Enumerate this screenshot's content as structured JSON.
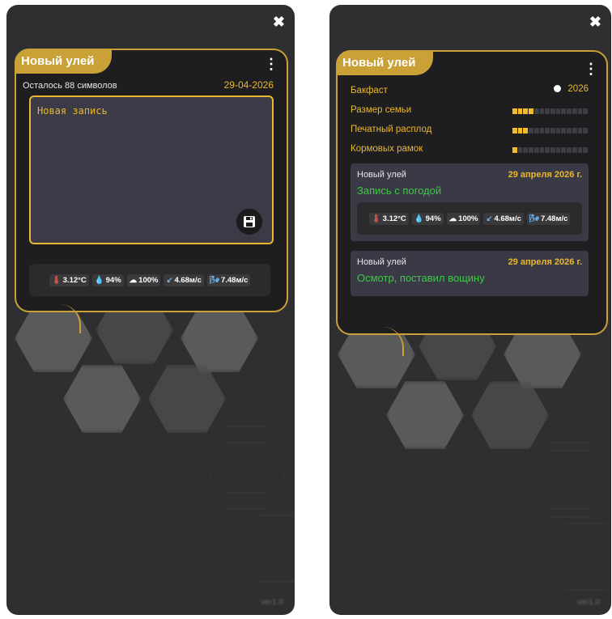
{
  "left": {
    "close_icon": "close-icon",
    "card_title": "Новый улей",
    "chars_left": "Осталось 88 символов",
    "date": "29-04-2026",
    "editor_value": "Новая запись",
    "weather": {
      "temp": "3.12°C",
      "humidity": "94%",
      "clouds": "100%",
      "wind": "4.68м/с",
      "gust": "7.48м/с"
    }
  },
  "right": {
    "card_title": "Новый улей",
    "breed_label": "Бакфаст",
    "breed_year": "2026",
    "rows": [
      {
        "label": "Размер семьи",
        "level": 4,
        "max": 14
      },
      {
        "label": "Печатный расплод",
        "level": 3,
        "max": 14
      },
      {
        "label": "Кормовых рамок",
        "level": 1,
        "max": 14
      }
    ],
    "entries": [
      {
        "hive": "Новый улей",
        "date": "29 апреля 2026 г.",
        "text": "Запись с погодой"
      },
      {
        "hive": "Новый улей",
        "date": "29 апреля 2026 г.",
        "text": "Осмотр, поставил вощину"
      }
    ],
    "weather": {
      "temp": "3.12°C",
      "humidity": "94%",
      "clouds": "100%",
      "wind": "4.68м/с",
      "gust": "7.48м/с"
    }
  },
  "colors": {
    "accent_gold": "#c9a137",
    "text_gold": "#e9b830",
    "green": "#3ec946",
    "background": "#2f2f31"
  }
}
